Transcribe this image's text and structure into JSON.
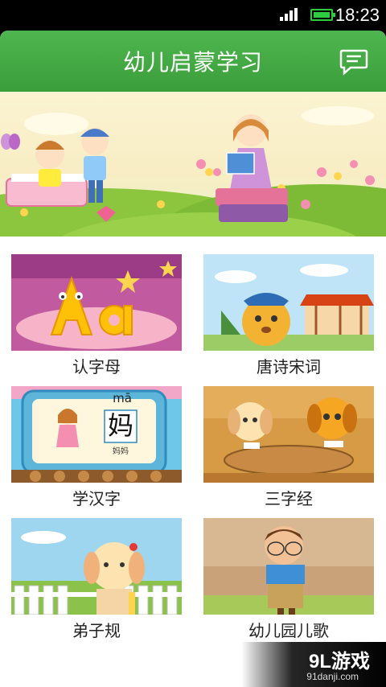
{
  "status_bar": {
    "time": "18:23",
    "signal_icon": "signal-bars-icon",
    "battery_icon": "battery-icon",
    "battery_color": "#2ecc40"
  },
  "header": {
    "title": "幼儿启蒙学习",
    "message_icon": "message-icon",
    "color": "#3fa63f"
  },
  "banner": {
    "image": "kids-reading-illustration"
  },
  "tiles": [
    {
      "label": "认字母",
      "icon": "alphabet-thumbnail"
    },
    {
      "label": "唐诗宋词",
      "icon": "poetry-thumbnail"
    },
    {
      "label": "学汉字",
      "icon": "chinese-characters-thumbnail",
      "pinyin": "mā",
      "hanzi": "妈",
      "caption": "妈妈"
    },
    {
      "label": "三字经",
      "icon": "three-character-classic-thumbnail"
    },
    {
      "label": "弟子规",
      "icon": "di-zi-gui-thumbnail"
    },
    {
      "label": "幼儿园儿歌",
      "icon": "nursery-songs-thumbnail"
    }
  ],
  "watermark": {
    "logo": "9L游戏",
    "url": "91danji.com"
  }
}
